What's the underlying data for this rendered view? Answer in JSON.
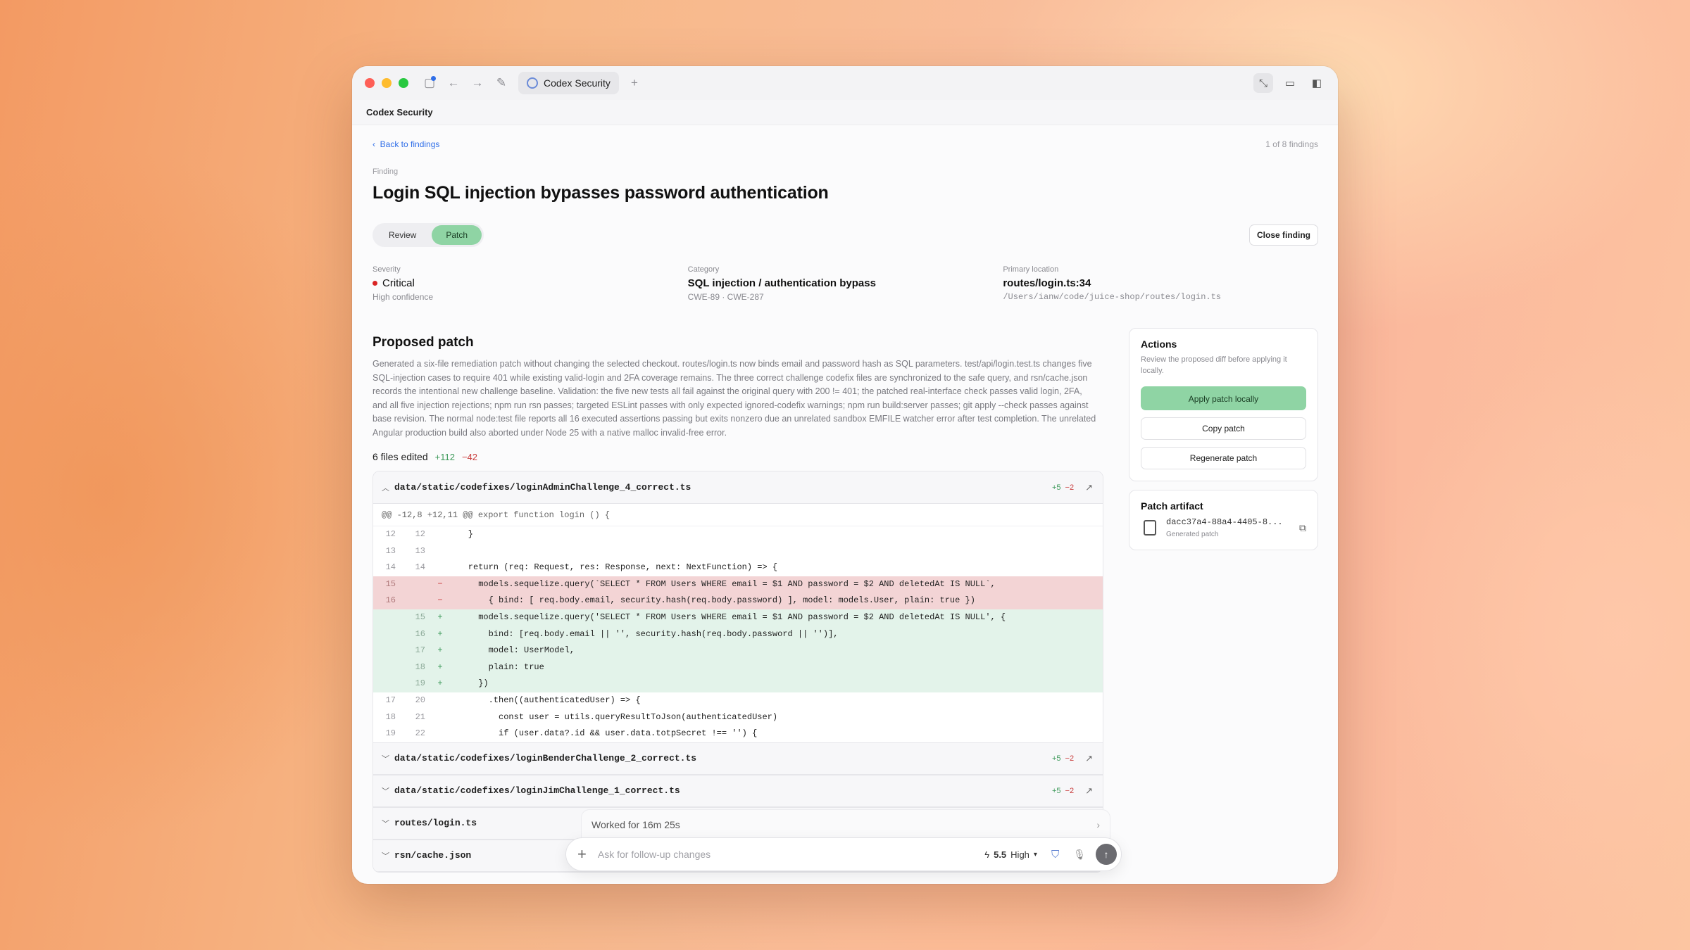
{
  "window": {
    "tab_title": "Codex Security",
    "app_title": "Codex Security"
  },
  "nav": {
    "back_label": "Back to findings",
    "counter": "1 of 8 findings"
  },
  "finding": {
    "label": "Finding",
    "title": "Login SQL injection bypasses password authentication",
    "tabs": [
      "Review",
      "Patch"
    ],
    "active_tab": "Patch",
    "close_label": "Close finding"
  },
  "meta": {
    "severity_label": "Severity",
    "severity": "Critical",
    "confidence": "High confidence",
    "category_label": "Category",
    "category": "SQL injection / authentication bypass",
    "cwe": "CWE-89 · CWE-287",
    "location_label": "Primary location",
    "location": "routes/login.ts:34",
    "path": "/Users/ianw/code/juice-shop/routes/login.ts"
  },
  "patch": {
    "heading": "Proposed patch",
    "description": "Generated a six-file remediation patch without changing the selected checkout. routes/login.ts now binds email and password hash as SQL parameters. test/api/login.test.ts changes five SQL-injection cases to require 401 while existing valid-login and 2FA coverage remains. The three correct challenge codefix files are synchronized to the safe query, and rsn/cache.json records the intentional new challenge baseline. Validation: the five new tests all fail against the original query with 200 != 401; the patched real-interface check passes valid login, 2FA, and all five injection rejections; npm run rsn passes; targeted ESLint passes with only expected ignored-codefix warnings; npm run build:server passes; git apply --check passes against base revision. The normal node:test file reports all 16 executed assertions passing but exits nonzero due an unrelated sandbox EMFILE watcher error after test completion. The unrelated Angular production build also aborted under Node 25 with a native malloc invalid-free error.",
    "files_edited": "6 files edited",
    "total_add": "+112",
    "total_del": "−42",
    "expanded_file": {
      "name": "data/static/codefixes/loginAdminChallenge_4_correct.ts",
      "add": "+5",
      "del": "−2",
      "hunk": "@@ -12,8 +12,11 @@ export function login () {",
      "lines": [
        {
          "o": "12",
          "n": "12",
          "s": "",
          "t": "    }",
          "k": "ctx"
        },
        {
          "o": "13",
          "n": "13",
          "s": "",
          "t": "",
          "k": "ctx"
        },
        {
          "o": "14",
          "n": "14",
          "s": "",
          "t": "    return (req: Request, res: Response, next: NextFunction) => {",
          "k": "ctx"
        },
        {
          "o": "15",
          "n": "",
          "s": "−",
          "t": "      models.sequelize.query(`SELECT * FROM Users WHERE email = $1 AND password = $2 AND deletedAt IS NULL`,",
          "k": "del"
        },
        {
          "o": "16",
          "n": "",
          "s": "−",
          "t": "        { bind: [ req.body.email, security.hash(req.body.password) ], model: models.User, plain: true })",
          "k": "del"
        },
        {
          "o": "",
          "n": "15",
          "s": "+",
          "t": "      models.sequelize.query('SELECT * FROM Users WHERE email = $1 AND password = $2 AND deletedAt IS NULL', {",
          "k": "add"
        },
        {
          "o": "",
          "n": "16",
          "s": "+",
          "t": "        bind: [req.body.email || '', security.hash(req.body.password || '')],",
          "k": "add"
        },
        {
          "o": "",
          "n": "17",
          "s": "+",
          "t": "        model: UserModel,",
          "k": "add"
        },
        {
          "o": "",
          "n": "18",
          "s": "+",
          "t": "        plain: true",
          "k": "add"
        },
        {
          "o": "",
          "n": "19",
          "s": "+",
          "t": "      })",
          "k": "add"
        },
        {
          "o": "17",
          "n": "20",
          "s": "",
          "t": "        .then((authenticatedUser) => {",
          "k": "ctx"
        },
        {
          "o": "18",
          "n": "21",
          "s": "",
          "t": "          const user = utils.queryResultToJson(authenticatedUser)",
          "k": "ctx"
        },
        {
          "o": "19",
          "n": "22",
          "s": "",
          "t": "          if (user.data?.id && user.data.totpSecret !== '') {",
          "k": "ctx"
        }
      ]
    },
    "collapsed_files": [
      {
        "name": "data/static/codefixes/loginBenderChallenge_2_correct.ts",
        "add": "+5",
        "del": "−2"
      },
      {
        "name": "data/static/codefixes/loginJimChallenge_1_correct.ts",
        "add": "+5",
        "del": "−2"
      },
      {
        "name": "routes/login.ts",
        "add": "",
        "del": ""
      },
      {
        "name": "rsn/cache.json",
        "add": "",
        "del": ""
      }
    ]
  },
  "actions": {
    "heading": "Actions",
    "description": "Review the proposed diff before applying it locally.",
    "apply_label": "Apply patch locally",
    "copy_label": "Copy patch",
    "regenerate_label": "Regenerate patch"
  },
  "artifact": {
    "heading": "Patch artifact",
    "name": "dacc37a4-88a4-4405-8...",
    "sub": "Generated patch"
  },
  "composer": {
    "worked": "Worked for 16m 25s",
    "placeholder": "Ask for follow-up changes",
    "model_version": "5.5",
    "model_effort": "High"
  },
  "colors": {
    "accent_green": "#8fd4a4",
    "link_blue": "#2f6ee8",
    "critical_red": "#d92424"
  }
}
